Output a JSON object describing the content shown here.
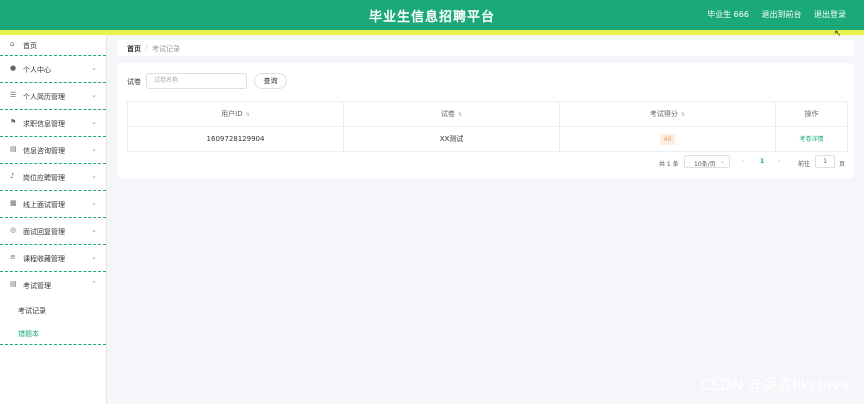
{
  "header": {
    "title": "毕业生信息招聘平台",
    "user": "毕业生 666",
    "back_to_front": "退出到前台",
    "logout": "退出登录"
  },
  "sidebar": {
    "items": [
      {
        "label": "首页",
        "icon": "home-icon"
      },
      {
        "label": "个人中心",
        "icon": "user-icon"
      },
      {
        "label": "个人简历管理",
        "icon": "list-icon"
      },
      {
        "label": "求职信息管理",
        "icon": "flag-icon"
      },
      {
        "label": "信息咨询管理",
        "icon": "clipboard-icon"
      },
      {
        "label": "岗位应聘管理",
        "icon": "microphone-icon"
      },
      {
        "label": "线上面试管理",
        "icon": "grid-icon"
      },
      {
        "label": "面试回复管理",
        "icon": "globe-icon"
      },
      {
        "label": "课程收藏管理",
        "icon": "sliders-icon"
      },
      {
        "label": "考试管理",
        "icon": "clipboard-icon"
      }
    ],
    "subitems": [
      {
        "label": "考试记录"
      },
      {
        "label": "错题本"
      }
    ]
  },
  "breadcrumb": {
    "home": "首页",
    "separator": "/",
    "current": "考试记录"
  },
  "search": {
    "label": "试卷",
    "placeholder": "试卷名称",
    "button": "查询"
  },
  "table": {
    "headers": [
      "用户ID",
      "试卷",
      "考试得分",
      "操作"
    ],
    "rows": [
      {
        "user_id": "1609728129904",
        "paper": "XX测试",
        "score": "40",
        "action": "考卷详情"
      }
    ]
  },
  "pagination": {
    "total": "共 1 条",
    "page_size": "10条/页",
    "prev": "‹",
    "current_page": "1",
    "next": "›",
    "goto_label": "前往",
    "goto_value": "1",
    "goto_unit": "页"
  },
  "watermark": "CSDN @吴言likeJava",
  "colors": {
    "accent": "#1ba97a",
    "highlight": "#e8f24a"
  }
}
